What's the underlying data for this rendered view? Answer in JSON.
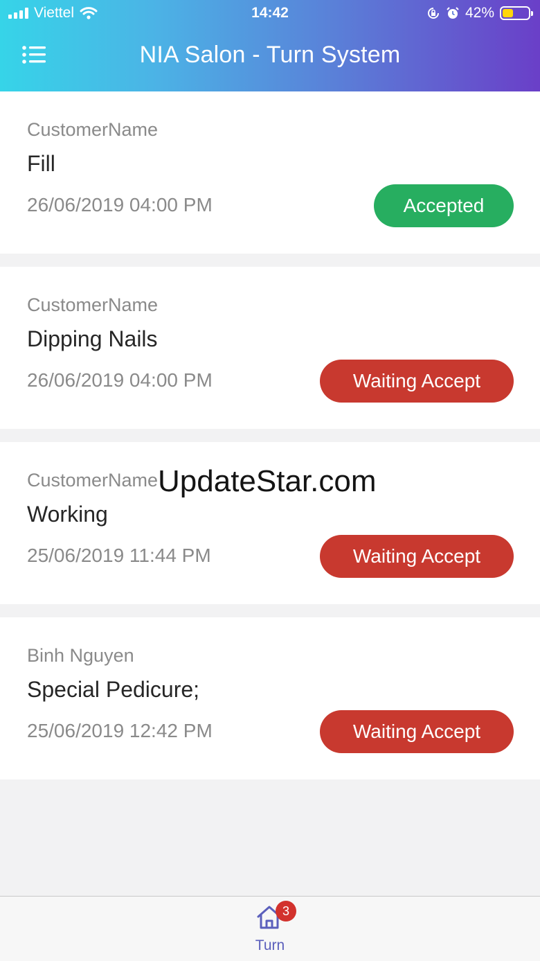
{
  "status_bar": {
    "carrier": "Viettel",
    "time": "14:42",
    "battery_percent": "42%",
    "battery_level": 0.42
  },
  "header": {
    "title": "NIA Salon - Turn System",
    "menu_icon": "list-icon"
  },
  "colors": {
    "accepted": "#27ae60",
    "waiting": "#c8392f",
    "tab_active": "#5b5fbc"
  },
  "turns": [
    {
      "customer": "CustomerName",
      "service": "Fill",
      "datetime": "26/06/2019 04:00 PM",
      "status": "Accepted",
      "status_type": "accepted"
    },
    {
      "customer": "CustomerName",
      "service": "Dipping Nails",
      "datetime": "26/06/2019 04:00 PM",
      "status": "Waiting Accept",
      "status_type": "waiting"
    },
    {
      "customer": "CustomerName",
      "service": "Working",
      "datetime": "25/06/2019 11:44 PM",
      "status": "Waiting Accept",
      "status_type": "waiting"
    },
    {
      "customer": "Binh Nguyen",
      "service": "Special Pedicure;",
      "datetime": "25/06/2019 12:42 PM",
      "status": "Waiting Accept",
      "status_type": "waiting"
    }
  ],
  "watermark": "UpdateStar.com",
  "tabbar": {
    "tabs": [
      {
        "label": "Turn",
        "icon": "home-icon",
        "badge": "3"
      }
    ]
  }
}
